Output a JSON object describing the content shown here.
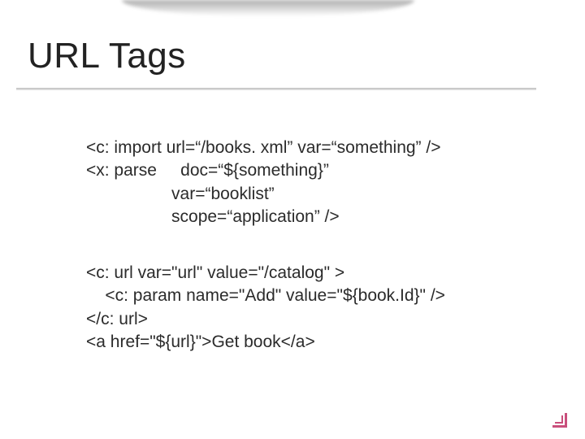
{
  "title": "URL Tags",
  "code_block_1": "<c: import url=“/books. xml” var=“something” />\n<x: parse     doc=“${something}”\n                  var=“booklist”\n                  scope=“application” />",
  "code_block_2": "<c: url var=\"url\" value=\"/catalog\" >\n    <c: param name=\"Add\" value=\"${book.Id}\" />\n</c: url>\n<a href=\"${url}\">Get book</a>"
}
